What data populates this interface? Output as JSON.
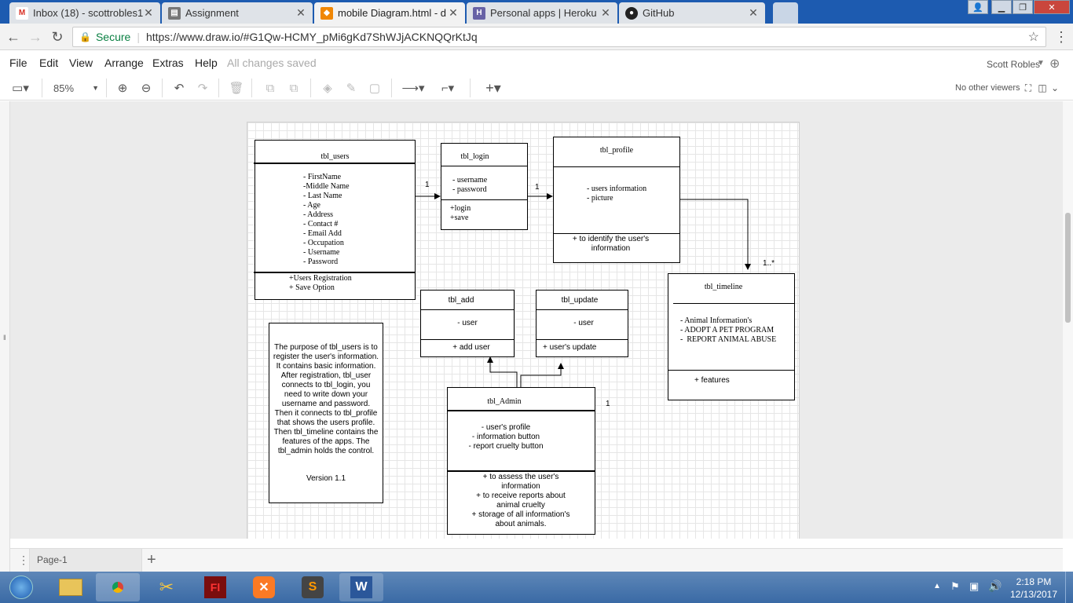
{
  "browser": {
    "tabs": [
      {
        "title": "Inbox (18) - scottrobles1",
        "icon": "gmail-icon",
        "active": false
      },
      {
        "title": "Assignment",
        "icon": "doc-icon",
        "active": false
      },
      {
        "title": "mobile Diagram.html - d",
        "icon": "drawio-icon",
        "active": true
      },
      {
        "title": "Personal apps | Heroku",
        "icon": "heroku-icon",
        "active": false
      },
      {
        "title": "GitHub",
        "icon": "github-icon",
        "active": false
      }
    ],
    "secure_label": "Secure",
    "url": "https://www.draw.io/#G1Qw-HCMY_pMi6gKd7ShWJjACKNQQrKtJq"
  },
  "menu": {
    "items": [
      "File",
      "Edit",
      "View",
      "Arrange",
      "Extras",
      "Help"
    ],
    "status": "All changes saved",
    "user": "Scott Robles"
  },
  "toolbar": {
    "zoom": "85%",
    "viewers": "No other viewers"
  },
  "diagram": {
    "tbl_users": {
      "title": "tbl_users",
      "attributes": "- FirstName\n-Middle Name\n- Last Name\n- Age\n- Address\n- Contact #\n- Email Add\n- Occupation\n- Username\n- Password",
      "methods": "+Users Registration\n+ Save Option"
    },
    "tbl_login": {
      "title": "tbl_login",
      "attributes": "- username\n- password",
      "methods": "+login\n+save"
    },
    "tbl_profile": {
      "title": "tbl_profile",
      "attributes": "- users information\n- picture",
      "methods": "+ to identify the user's\ninformation"
    },
    "tbl_timeline": {
      "title": "tbl_timeline",
      "attributes": "- Animal Information's\n- ADOPT A PET PROGRAM\n-  REPORT ANIMAL ABUSE",
      "methods": "+ features"
    },
    "tbl_add": {
      "title": "tbl_add",
      "attributes": "- user",
      "methods": "+ add user"
    },
    "tbl_update": {
      "title": "tbl_update",
      "attributes": "- user",
      "methods": "+ user's update"
    },
    "tbl_admin": {
      "title": "tbl_Admin",
      "attributes": "- user's profile\n- information button\n- report cruelty button",
      "methods": "+ to assess the user's\ninformation\n+ to receive reports about\nanimal cruelty\n+ storage of all information's\nabout animals."
    },
    "note": {
      "text": "The purpose of tbl_users is to\nregister the user's information.\nIt contains basic information.\nAfter registration, tbl_user\nconnects to tbl_login, you\nneed to write down your\nusername and password.\nThen it connects to tbl_profile\nthat shows the users profile.\nThen tbl_timeline contains the\nfeatures of the apps. The\ntbl_admin holds the control.",
      "version": "Version 1.1"
    },
    "labels": {
      "users_login": "1",
      "login_profile": "1",
      "profile_timeline": "1..*",
      "admin": "1"
    }
  },
  "pages": {
    "current": "Page-1"
  },
  "taskbar": {
    "time": "2:18 PM",
    "date": "12/13/2017"
  }
}
